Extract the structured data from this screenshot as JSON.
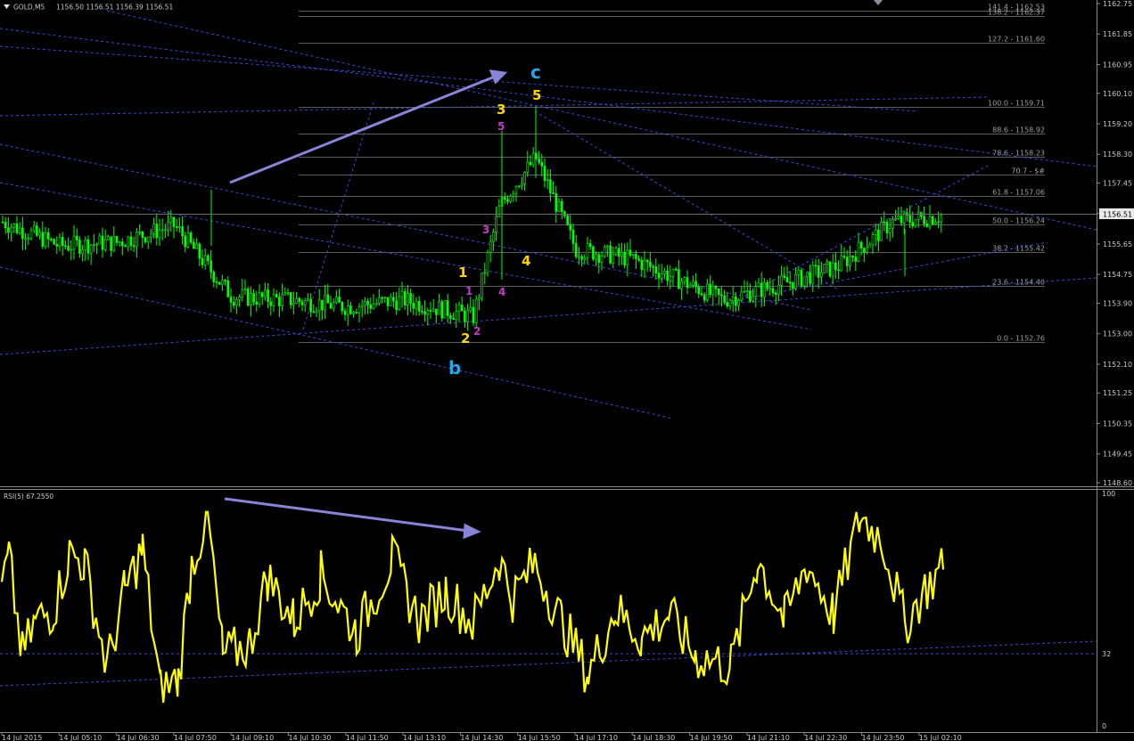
{
  "header": {
    "symbol": "GOLD,M5",
    "ohlc": "1156.50 1156.51 1156.39 1156.51"
  },
  "rsi_header": "RSI(5) 67.2550",
  "current_price": "1156.51",
  "colors": {
    "bg": "#000000",
    "candle": "#00ff00",
    "rsi": "#ffff00",
    "trend": "#4a56e0",
    "fib": "#5a5e5a",
    "arrow": "#8a84d8"
  },
  "price_ticks": [
    "1162.75",
    "1161.85",
    "1160.95",
    "1160.10",
    "1159.20",
    "1158.30",
    "1157.45",
    "1156.55",
    "1155.65",
    "1154.75",
    "1153.90",
    "1153.00",
    "1152.10",
    "1151.25",
    "1150.35",
    "1149.45",
    "1148.60"
  ],
  "rsi_ticks": [
    "100",
    "32",
    "0"
  ],
  "time_labels": [
    "14 Jul 2015",
    "14 Jul 05:10",
    "14 Jul 06:30",
    "14 Jul 07:50",
    "14 Jul 09:10",
    "14 Jul 10:30",
    "14 Jul 11:50",
    "14 Jul 13:10",
    "14 Jul 14:30",
    "14 Jul 15:50",
    "14 Jul 17:10",
    "14 Jul 18:30",
    "14 Jul 19:50",
    "14 Jul 21:10",
    "14 Jul 22:30",
    "14 Jul 23:50",
    "15 Jul 02:10"
  ],
  "fib_levels": [
    {
      "label": "141.4 - 1162.53",
      "price": 1162.53
    },
    {
      "label": "138.2 - 1162.37",
      "price": 1162.37
    },
    {
      "label": "127.2 - 1161.60",
      "price": 1161.6
    },
    {
      "label": "100.0 - 1159.71",
      "price": 1159.71
    },
    {
      "label": "88.6 - 1158.92",
      "price": 1158.92
    },
    {
      "label": "78.6 - 1158.23",
      "price": 1158.23
    },
    {
      "label": "70.7 - $#",
      "price": 1157.7
    },
    {
      "label": "61.8 - 1157.06",
      "price": 1157.06
    },
    {
      "label": "50.0 - 1156.24",
      "price": 1156.24
    },
    {
      "label": "38.2 - 1155.42",
      "price": 1155.42
    },
    {
      "label": "23.6 - 1154.40",
      "price": 1154.4
    },
    {
      "label": "0.0 - 1152.76",
      "price": 1152.76
    }
  ],
  "wave_labels": [
    {
      "text": "c",
      "color": "#29a6e8"
    },
    {
      "text": "b",
      "color": "#29a6e8"
    },
    {
      "text": "1",
      "color": "#ffd700"
    },
    {
      "text": "2",
      "color": "#ffd700"
    },
    {
      "text": "3",
      "color": "#ffd700"
    },
    {
      "text": "4",
      "color": "#ffd700"
    },
    {
      "text": "5",
      "color": "#ffd700"
    },
    {
      "text": "1",
      "color": "#c03cc8"
    },
    {
      "text": "2",
      "color": "#c03cc8"
    },
    {
      "text": "3",
      "color": "#c03cc8"
    },
    {
      "text": "4",
      "color": "#c03cc8"
    },
    {
      "text": "5",
      "color": "#c03cc8"
    }
  ],
  "chart_data": [
    {
      "type": "candlestick",
      "title": "GOLD,M5",
      "ylim": [
        1148.6,
        1163.0
      ],
      "x_range": [
        "14 Jul 2015",
        "15 Jul 02:10"
      ],
      "close_path": [
        {
          "x": "14 Jul 2015",
          "price": 1156.3
        },
        {
          "x": "14 Jul 05:10",
          "price": 1155.6
        },
        {
          "x": "14 Jul 06:30",
          "price": 1155.7
        },
        {
          "x": "14 Jul 07:50",
          "price": 1156.2
        },
        {
          "x": "14 Jul 09:10",
          "price": 1154.1
        },
        {
          "x": "14 Jul 10:30",
          "price": 1154.0
        },
        {
          "x": "14 Jul 11:50",
          "price": 1153.8
        },
        {
          "x": "14 Jul 13:10",
          "price": 1154.0
        },
        {
          "x": "14 Jul 14:30",
          "price": 1153.5
        },
        {
          "x": "14 Jul 14:45",
          "price": 1156.8
        },
        {
          "x": "14 Jul 15:50",
          "price": 1158.2
        },
        {
          "x": "14 Jul 17:10",
          "price": 1155.5
        },
        {
          "x": "14 Jul 18:30",
          "price": 1155.2
        },
        {
          "x": "14 Jul 19:50",
          "price": 1154.0
        },
        {
          "x": "14 Jul 21:10",
          "price": 1154.5
        },
        {
          "x": "14 Jul 22:30",
          "price": 1155.0
        },
        {
          "x": "14 Jul 23:50",
          "price": 1156.3
        },
        {
          "x": "15 Jul 02:10",
          "price": 1156.5
        }
      ],
      "last_price": 1156.51
    },
    {
      "type": "line",
      "title": "RSI(5) 67.2550",
      "ylim": [
        0,
        100
      ],
      "level": 32,
      "last_value": 67.255
    }
  ]
}
